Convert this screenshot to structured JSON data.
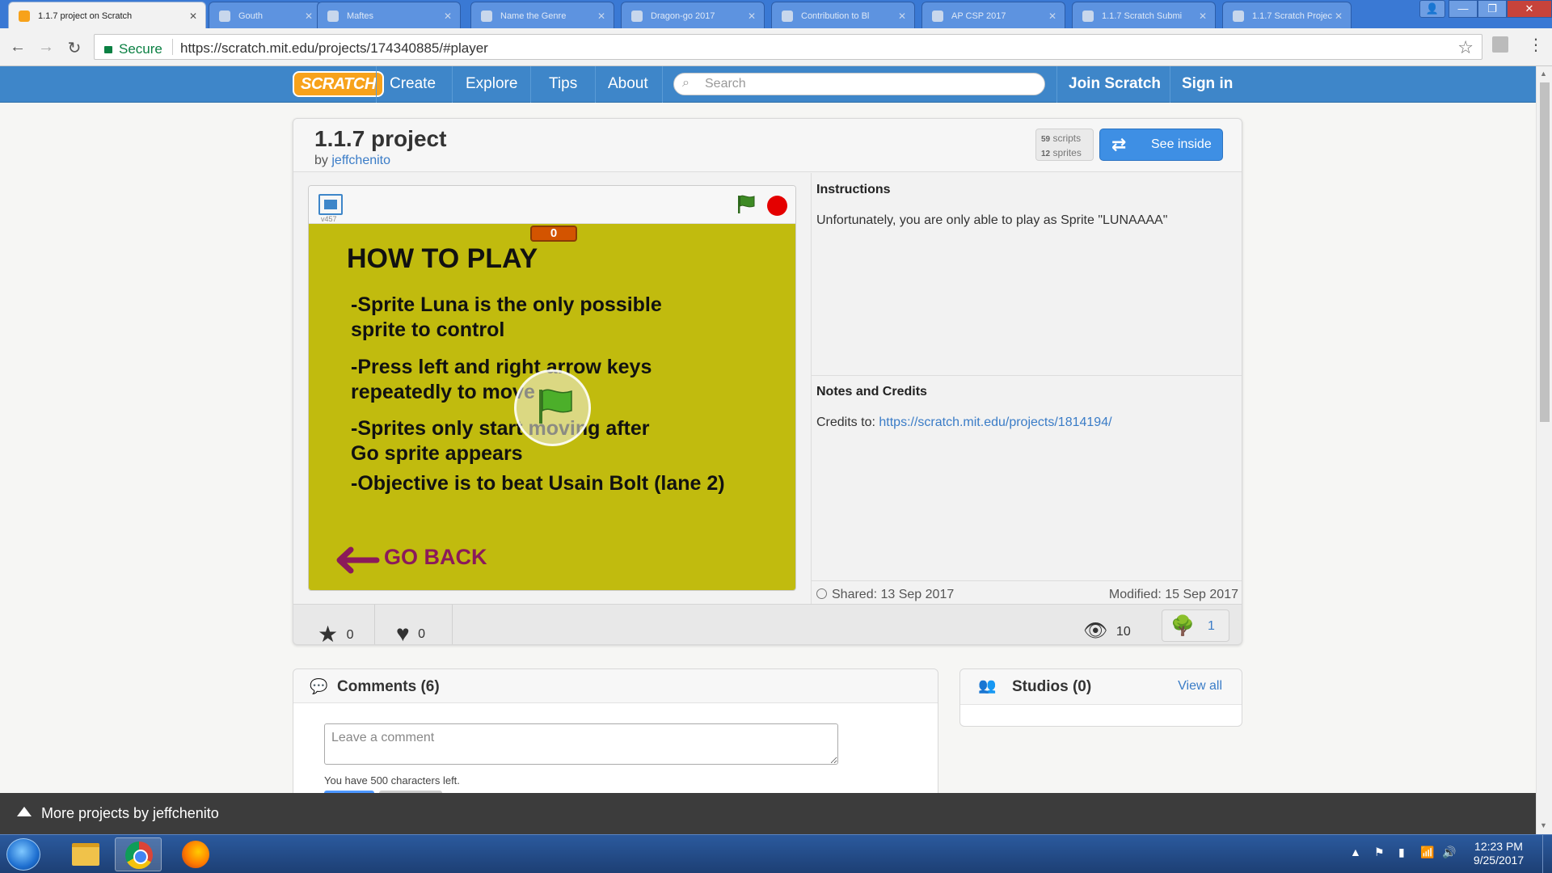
{
  "browser": {
    "active_tab_title": "1.1.7 project on Scratch",
    "tabs_inactive": [
      "",
      "Gouth",
      "Maftes",
      "Name the Genre",
      "Dragon-go 2017",
      "Contribution to Bl",
      "AP CSP 2017",
      "1.1.7 Scratch Submi",
      "1.1.7 Scratch Projec"
    ],
    "security_label": "Secure",
    "url": "https://scratch.mit.edu/projects/174340885/#player"
  },
  "scratch_nav": {
    "logo": "SCRATCH",
    "links": [
      "Create",
      "Explore",
      "Tips",
      "About"
    ],
    "search_placeholder": "Search",
    "join": "Join Scratch",
    "sign_in": "Sign in"
  },
  "project": {
    "title": "1.1.7 project",
    "by_prefix": "by",
    "author": "jeffchenito",
    "scripts_count": "59",
    "scripts_label": "scripts",
    "sprites_count": "12",
    "sprites_label": "sprites",
    "see_inside": "See inside"
  },
  "player": {
    "version": "v457",
    "score": "0",
    "stage_title": "HOW TO PLAY",
    "rules": [
      [
        "-Sprite Luna is the only possible",
        "sprite to control"
      ],
      [
        "-Press left and right arrow keys",
        "repeatedly to move"
      ],
      [
        "-Sprites only start moving after",
        "Go sprite appears"
      ],
      [
        "-Objective is to beat Usain Bolt (lane 2)"
      ]
    ],
    "go_back": "GO BACK"
  },
  "info": {
    "instructions_heading": "Instructions",
    "instructions_text": "Unfortunately, you are only able to play as Sprite \"LUNAAAA\"",
    "notes_heading": "Notes and Credits",
    "credits_prefix": "Credits to:",
    "credits_link": "https://scratch.mit.edu/projects/1814194/",
    "shared": "Shared: 13 Sep 2017",
    "modified": "Modified: 15 Sep 2017"
  },
  "toolbar": {
    "favorites": "0",
    "loves": "0",
    "views": "10",
    "remixes": "1"
  },
  "comments": {
    "title": "Comments (6)",
    "placeholder": "Leave a comment",
    "chars_left": "You have 500 characters left."
  },
  "studios": {
    "title": "Studios (0)",
    "view_all": "View all"
  },
  "more_projects": "More projects by jeffchenito",
  "taskbar": {
    "time": "12:23 PM",
    "date": "9/25/2017"
  },
  "colors": {
    "scratch_blue": "#3e86c9",
    "stage_yellow": "#c1bb0e",
    "link_blue": "#3a7cc7",
    "go_back": "#8b1a5a"
  }
}
